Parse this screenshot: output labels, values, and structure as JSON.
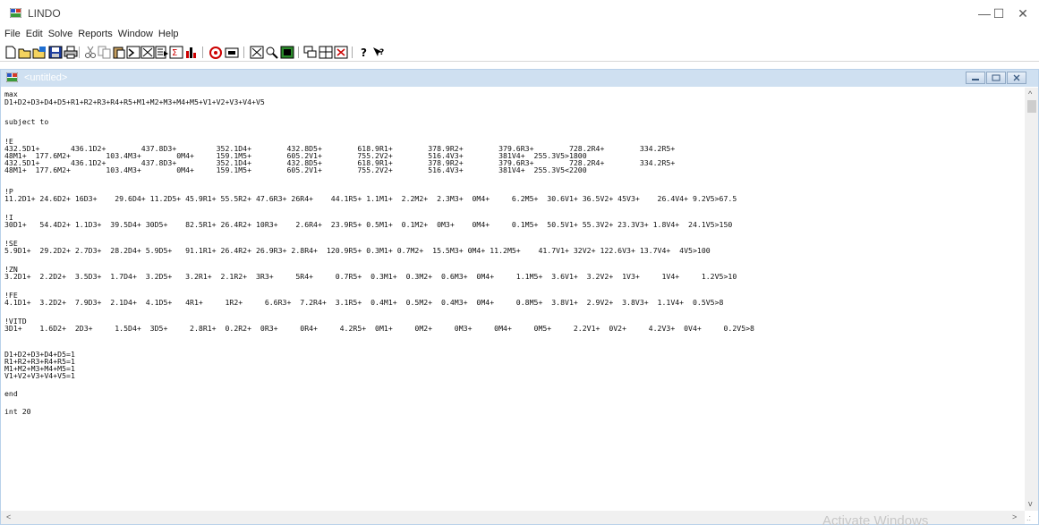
{
  "window": {
    "title": "LINDO",
    "minimize": "—",
    "maximize": "☐",
    "close": "✕"
  },
  "menu": [
    "File",
    "Edit",
    "Solve",
    "Reports",
    "Window",
    "Help"
  ],
  "toolbar_icons": [
    "new-icon",
    "open-icon",
    "save-as-icon",
    "save-icon",
    "print-icon",
    "cut-icon",
    "copy-icon",
    "paste-icon",
    "find-icon",
    "clear-icon",
    "paste-symbol-icon",
    "sum-icon",
    "chart-icon",
    "compile-icon",
    "solve-icon",
    "zoom-fit-icon",
    "zoom-icon",
    "window-icon",
    "cascade-icon",
    "tile-icon",
    "close-all-icon",
    "help-icon",
    "context-help-icon"
  ],
  "document": {
    "title": "<untitled>",
    "lines": [
      "max",
      "D1+D2+D3+D4+D5+R1+R2+R3+R4+R5+M1+M2+M3+M4+M5+V1+V2+V3+V4+V5",
      "",
      "subject to",
      "",
      "!E",
      "432.5D1+       436.1D2+        437.8D3+         352.1D4+        432.8D5+        618.9R1+        378.9R2+        379.6R3+        728.2R4+        334.2R5+",
      "48M1+  177.6M2+        103.4M3+        0M4+     159.1M5+        605.2V1+        755.2V2+        516.4V3+        381V4+  255.3V5>1800",
      "432.5D1+       436.1D2+        437.8D3+         352.1D4+        432.8D5+        618.9R1+        378.9R2+        379.6R3+        728.2R4+        334.2R5+",
      "48M1+  177.6M2+        103.4M3+        0M4+     159.1M5+        605.2V1+        755.2V2+        516.4V3+        381V4+  255.3V5<2200",
      "",
      "!P",
      "11.2D1+ 24.6D2+ 16D3+    29.6D4+ 11.2D5+ 45.9R1+ 55.5R2+ 47.6R3+ 26R4+    44.1R5+ 1.1M1+  2.2M2+  2.3M3+  0M4+     6.2M5+  30.6V1+ 36.5V2+ 45V3+    26.4V4+ 9.2V5>67.5",
      "",
      "!I",
      "30D1+   54.4D2+ 1.1D3+  39.5D4+ 30D5+    82.5R1+ 26.4R2+ 10R3+    2.6R4+  23.9R5+ 0.5M1+  0.1M2+  0M3+    0M4+     0.1M5+  50.5V1+ 55.3V2+ 23.3V3+ 1.8V4+  24.1V5>150",
      "",
      "!SE",
      "5.9D1+  29.2D2+ 2.7D3+  28.2D4+ 5.9D5+   91.1R1+ 26.4R2+ 26.9R3+ 2.8R4+  120.9R5+ 0.3M1+ 0.7M2+  15.5M3+ 0M4+ 11.2M5+    41.7V1+ 32V2+ 122.6V3+ 13.7V4+  4V5>100",
      "",
      "!ZN",
      "3.2D1+  2.2D2+  3.5D3+  1.7D4+  3.2D5+   3.2R1+  2.1R2+  3R3+     5R4+     0.7R5+  0.3M1+  0.3M2+  0.6M3+  0M4+     1.1M5+  3.6V1+  3.2V2+  1V3+     1V4+     1.2V5>10",
      "",
      "!FE",
      "4.1D1+  3.2D2+  7.9D3+  2.1D4+  4.1D5+   4R1+     1R2+     6.6R3+  7.2R4+  3.1R5+  0.4M1+  0.5M2+  0.4M3+  0M4+     0.8M5+  3.8V1+  2.9V2+  3.8V3+  1.1V4+  0.5V5>8",
      "",
      "!VITD",
      "3D1+    1.6D2+  2D3+     1.5D4+  3D5+     2.8R1+  0.2R2+  0R3+     0R4+     4.2R5+  0M1+     0M2+     0M3+     0M4+     0M5+     2.2V1+  0V2+     4.2V3+  0V4+     0.2V5>8",
      "",
      "",
      "D1+D2+D3+D4+D5=1",
      "R1+R2+R3+R4+R5=1",
      "M1+M2+M3+M4+M5=1",
      "V1+V2+V3+V4+V5=1",
      "",
      "end",
      "",
      "int 20"
    ]
  },
  "watermark": "Activate Windows"
}
